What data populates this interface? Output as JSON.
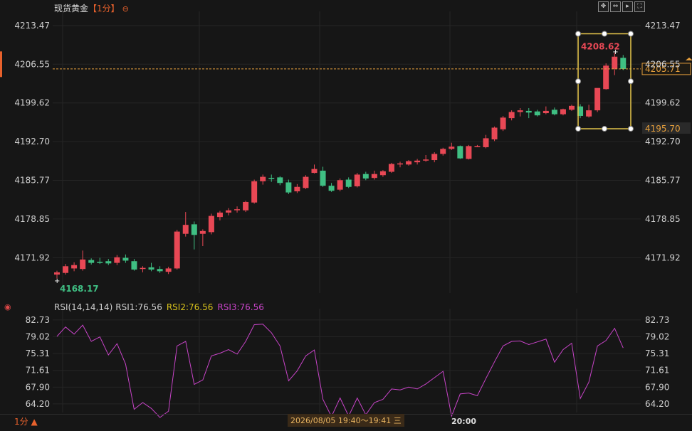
{
  "header": {
    "title": "现货黄金",
    "period_tag": "【1分】",
    "toolbar_icons": [
      "crosshair-icon",
      "fit-icon",
      "play-icon",
      "fullscreen-icon"
    ]
  },
  "rsi_header": {
    "label": "RSI(14,14,14)",
    "rsi1": "RSI1:76.56",
    "rsi2": "RSI2:76.56",
    "rsi3": "RSI3:76.56"
  },
  "footer": {
    "period": "1分 ▲",
    "time_range": "2026/08/05 19:40～19:41 三",
    "time_tick": "20:00"
  },
  "colors": {
    "up": "#e84855",
    "down": "#3fbf83",
    "rsi_line": "#c844c8",
    "current_price": "#e8a03c",
    "selection": "#e8c84c"
  },
  "chart_data": [
    {
      "type": "candlestick",
      "ylim": [
        4165.6,
        4215.5
      ],
      "y_ticks": [
        "4213.47",
        "4206.55",
        "4199.62",
        "4192.70",
        "4185.77",
        "4178.85",
        "4171.92"
      ],
      "annotations": {
        "low": "4168.17",
        "high": "4208.62",
        "current_price": "4205.71",
        "selection_low": "4195.70"
      },
      "candles": [
        {
          "o": 4168.9,
          "h": 4169.6,
          "l": 4168.2,
          "c": 4169.3
        },
        {
          "o": 4169.2,
          "h": 4170.8,
          "l": 4168.9,
          "c": 4170.4
        },
        {
          "o": 4170.0,
          "h": 4171.1,
          "l": 4169.5,
          "c": 4170.6
        },
        {
          "o": 4169.9,
          "h": 4173.2,
          "l": 4169.6,
          "c": 4171.6
        },
        {
          "o": 4171.5,
          "h": 4171.8,
          "l": 4170.7,
          "c": 4171.0
        },
        {
          "o": 4171.2,
          "h": 4171.9,
          "l": 4170.8,
          "c": 4171.0
        },
        {
          "o": 4171.3,
          "h": 4171.7,
          "l": 4170.6,
          "c": 4170.9
        },
        {
          "o": 4171.0,
          "h": 4172.4,
          "l": 4170.6,
          "c": 4172.0
        },
        {
          "o": 4171.9,
          "h": 4172.5,
          "l": 4171.0,
          "c": 4171.4
        },
        {
          "o": 4171.3,
          "h": 4171.7,
          "l": 4169.6,
          "c": 4169.8
        },
        {
          "o": 4169.9,
          "h": 4170.4,
          "l": 4169.3,
          "c": 4170.1
        },
        {
          "o": 4170.2,
          "h": 4171.0,
          "l": 4169.5,
          "c": 4169.8
        },
        {
          "o": 4169.9,
          "h": 4170.4,
          "l": 4169.2,
          "c": 4169.5
        },
        {
          "o": 4169.4,
          "h": 4170.3,
          "l": 4169.0,
          "c": 4170.0
        },
        {
          "o": 4170.0,
          "h": 4176.9,
          "l": 4169.8,
          "c": 4176.6
        },
        {
          "o": 4176.2,
          "h": 4180.1,
          "l": 4175.7,
          "c": 4177.8
        },
        {
          "o": 4177.9,
          "h": 4178.4,
          "l": 4173.4,
          "c": 4176.0
        },
        {
          "o": 4176.2,
          "h": 4177.0,
          "l": 4174.0,
          "c": 4176.7
        },
        {
          "o": 4176.5,
          "h": 4179.8,
          "l": 4176.1,
          "c": 4179.4
        },
        {
          "o": 4179.2,
          "h": 4180.3,
          "l": 4178.6,
          "c": 4180.0
        },
        {
          "o": 4180.0,
          "h": 4180.8,
          "l": 4179.5,
          "c": 4180.4
        },
        {
          "o": 4180.5,
          "h": 4181.1,
          "l": 4180.0,
          "c": 4180.6
        },
        {
          "o": 4180.4,
          "h": 4182.1,
          "l": 4180.1,
          "c": 4181.9
        },
        {
          "o": 4181.8,
          "h": 4185.9,
          "l": 4181.6,
          "c": 4185.6
        },
        {
          "o": 4185.6,
          "h": 4186.8,
          "l": 4185.0,
          "c": 4186.4
        },
        {
          "o": 4186.2,
          "h": 4186.8,
          "l": 4185.5,
          "c": 4186.1
        },
        {
          "o": 4186.3,
          "h": 4186.5,
          "l": 4184.9,
          "c": 4185.3
        },
        {
          "o": 4185.4,
          "h": 4185.9,
          "l": 4183.3,
          "c": 4183.6
        },
        {
          "o": 4183.8,
          "h": 4185.1,
          "l": 4183.5,
          "c": 4184.6
        },
        {
          "o": 4184.4,
          "h": 4186.7,
          "l": 4184.2,
          "c": 4186.4
        },
        {
          "o": 4187.1,
          "h": 4188.6,
          "l": 4187.0,
          "c": 4187.8
        },
        {
          "o": 4187.5,
          "h": 4188.2,
          "l": 4184.6,
          "c": 4184.8
        },
        {
          "o": 4184.8,
          "h": 4185.3,
          "l": 4183.7,
          "c": 4183.9
        },
        {
          "o": 4184.1,
          "h": 4186.1,
          "l": 4183.8,
          "c": 4185.8
        },
        {
          "o": 4185.9,
          "h": 4186.3,
          "l": 4184.4,
          "c": 4184.6
        },
        {
          "o": 4184.7,
          "h": 4187.1,
          "l": 4184.5,
          "c": 4186.8
        },
        {
          "o": 4186.9,
          "h": 4187.3,
          "l": 4185.8,
          "c": 4186.1
        },
        {
          "o": 4186.2,
          "h": 4187.5,
          "l": 4185.9,
          "c": 4186.9
        },
        {
          "o": 4186.7,
          "h": 4187.6,
          "l": 4186.4,
          "c": 4187.4
        },
        {
          "o": 4187.3,
          "h": 4188.9,
          "l": 4187.1,
          "c": 4188.7
        },
        {
          "o": 4188.7,
          "h": 4189.1,
          "l": 4188.1,
          "c": 4188.8
        },
        {
          "o": 4188.6,
          "h": 4189.4,
          "l": 4188.4,
          "c": 4189.2
        },
        {
          "o": 4189.0,
          "h": 4189.6,
          "l": 4188.6,
          "c": 4189.3
        },
        {
          "o": 4189.3,
          "h": 4190.3,
          "l": 4189.1,
          "c": 4189.5
        },
        {
          "o": 4189.4,
          "h": 4190.8,
          "l": 4189.0,
          "c": 4190.5
        },
        {
          "o": 4190.5,
          "h": 4191.6,
          "l": 4190.2,
          "c": 4191.4
        },
        {
          "o": 4191.4,
          "h": 4192.5,
          "l": 4191.2,
          "c": 4191.8
        },
        {
          "o": 4191.9,
          "h": 4192.0,
          "l": 4189.6,
          "c": 4189.7
        },
        {
          "o": 4189.6,
          "h": 4192.1,
          "l": 4189.5,
          "c": 4191.9
        },
        {
          "o": 4191.9,
          "h": 4192.1,
          "l": 4191.7,
          "c": 4191.9
        },
        {
          "o": 4191.7,
          "h": 4193.9,
          "l": 4191.5,
          "c": 4193.3
        },
        {
          "o": 4193.1,
          "h": 4195.4,
          "l": 4192.8,
          "c": 4195.2
        },
        {
          "o": 4194.9,
          "h": 4197.3,
          "l": 4194.6,
          "c": 4197.0
        },
        {
          "o": 4196.9,
          "h": 4198.3,
          "l": 4196.5,
          "c": 4198.0
        },
        {
          "o": 4198.0,
          "h": 4198.7,
          "l": 4197.2,
          "c": 4198.3
        },
        {
          "o": 4198.2,
          "h": 4198.7,
          "l": 4196.9,
          "c": 4197.9
        },
        {
          "o": 4198.1,
          "h": 4198.4,
          "l": 4197.2,
          "c": 4197.4
        },
        {
          "o": 4197.8,
          "h": 4199.0,
          "l": 4197.6,
          "c": 4198.2
        },
        {
          "o": 4198.4,
          "h": 4198.8,
          "l": 4197.4,
          "c": 4197.6
        },
        {
          "o": 4197.6,
          "h": 4198.6,
          "l": 4197.4,
          "c": 4198.5
        },
        {
          "o": 4198.4,
          "h": 4199.3,
          "l": 4198.2,
          "c": 4199.1
        },
        {
          "o": 4199.0,
          "h": 4199.4,
          "l": 4196.9,
          "c": 4197.3
        },
        {
          "o": 4197.2,
          "h": 4199.3,
          "l": 4197.0,
          "c": 4198.3
        },
        {
          "o": 4198.3,
          "h": 4201.4,
          "l": 4198.0,
          "c": 4202.3
        },
        {
          "o": 4202.1,
          "h": 4206.7,
          "l": 4202.0,
          "c": 4206.3
        },
        {
          "o": 4205.7,
          "h": 4208.6,
          "l": 4204.6,
          "c": 4207.9
        },
        {
          "o": 4207.7,
          "h": 4208.2,
          "l": 4205.5,
          "c": 4205.7
        }
      ]
    },
    {
      "type": "line",
      "title": "RSI(14,14,14)",
      "ylim": [
        62.3,
        84.6
      ],
      "y_ticks": [
        "82.73",
        "79.02",
        "75.31",
        "71.61",
        "67.90",
        "64.20"
      ],
      "series": [
        {
          "name": "RSI3",
          "values": [
            79.1,
            81.2,
            79.6,
            81.6,
            78.0,
            79.0,
            75.0,
            77.5,
            73.0,
            63.0,
            64.5,
            63.2,
            61.2,
            62.6,
            77.0,
            78.0,
            68.5,
            69.5,
            74.8,
            75.4,
            76.2,
            75.2,
            78.0,
            81.7,
            81.8,
            79.9,
            77.0,
            69.3,
            71.5,
            74.8,
            76.1,
            65.2,
            61.4,
            65.5,
            61.5,
            65.5,
            61.8,
            64.5,
            65.2,
            67.5,
            67.3,
            67.9,
            67.5,
            68.6,
            70.0,
            71.4,
            61.5,
            66.4,
            66.6,
            66.0,
            69.8,
            73.5,
            77.0,
            78.0,
            78.1,
            77.3,
            77.9,
            78.5,
            73.4,
            76.2,
            77.6,
            65.4,
            69.0,
            77.0,
            78.2,
            80.9,
            76.56
          ]
        }
      ]
    }
  ]
}
